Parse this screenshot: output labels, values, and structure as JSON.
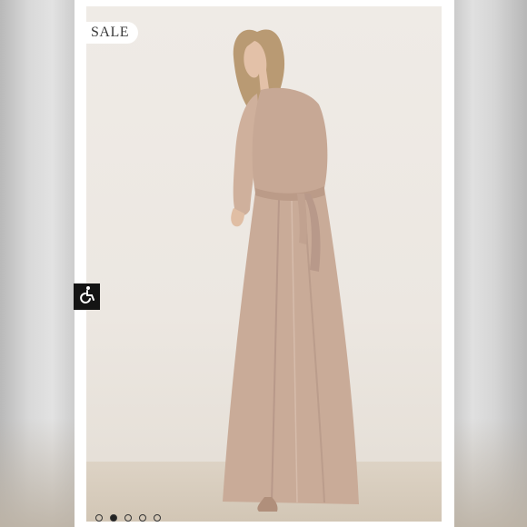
{
  "listing": {
    "badge": "SALE",
    "carousel": {
      "slides": 5,
      "active_index": 1
    }
  },
  "icons": {
    "accessibility": "wheelchair-icon"
  },
  "colors": {
    "dress": "#c9ab98",
    "backdrop": "#ece7e1",
    "floor": "#d4c8b8",
    "badge_bg": "#ffffff",
    "accessibility_bg": "#141414"
  }
}
